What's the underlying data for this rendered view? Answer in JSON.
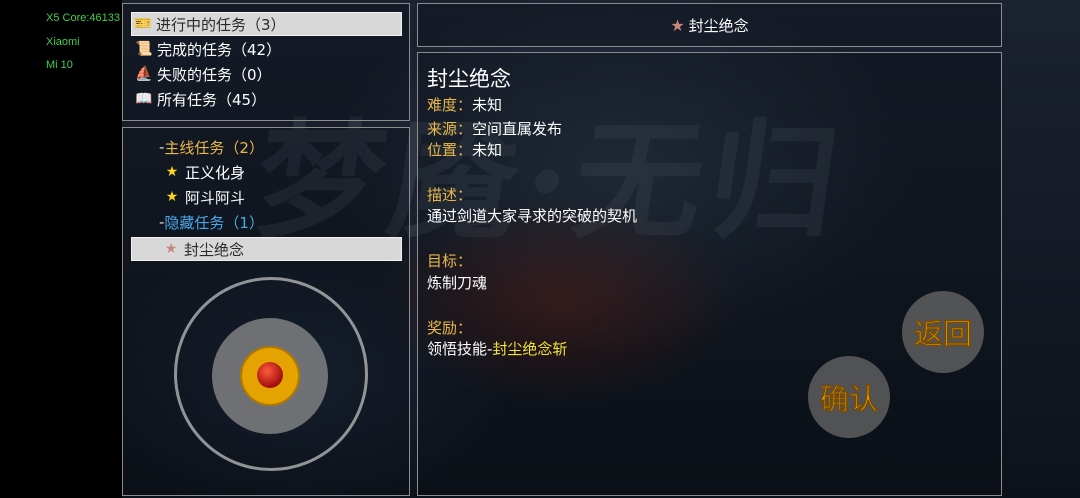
{
  "status_bar": [
    "X5 Core:46133",
    "Xiaomi",
    "Mi 10"
  ],
  "filters": [
    {
      "label": "进行中的任务（3）",
      "icon": "task-card-icon",
      "selected": true
    },
    {
      "label": "完成的任务（42）",
      "icon": "scroll-icon",
      "selected": false
    },
    {
      "label": "失败的任务（0）",
      "icon": "flag-icon",
      "selected": false
    },
    {
      "label": "所有任务（45）",
      "icon": "book-icon",
      "selected": false
    }
  ],
  "tree": {
    "main_category": "主线任务（2）",
    "main_items": [
      "正义化身",
      "阿斗阿斗"
    ],
    "hidden_category": "隐藏任务（1）",
    "hidden_items": [
      "封尘绝念"
    ],
    "dash": "-"
  },
  "header_title": "封尘绝念",
  "detail": {
    "title": "封尘绝念",
    "difficulty_label": "难度：",
    "difficulty": "未知",
    "source_label": "来源：",
    "source": "空间直属发布",
    "location_label": "位置：",
    "location": "未知",
    "desc_label": "描述：",
    "desc": "通过剑道大家寻求的突破的契机",
    "goal_label": "目标：",
    "goal": "炼制刀魂",
    "reward_label": "奖励：",
    "reward_prefix": "领悟技能-",
    "reward_highlight": "封尘绝念斩"
  },
  "watermark": "梦魇·无归",
  "buttons": {
    "back": "返回",
    "confirm": "确认"
  },
  "colors": {
    "accent_gold": "#e8b84a",
    "hidden_blue": "#4aa8e8",
    "highlight_yellow": "#f2e233",
    "status_green": "#3fd14a"
  }
}
